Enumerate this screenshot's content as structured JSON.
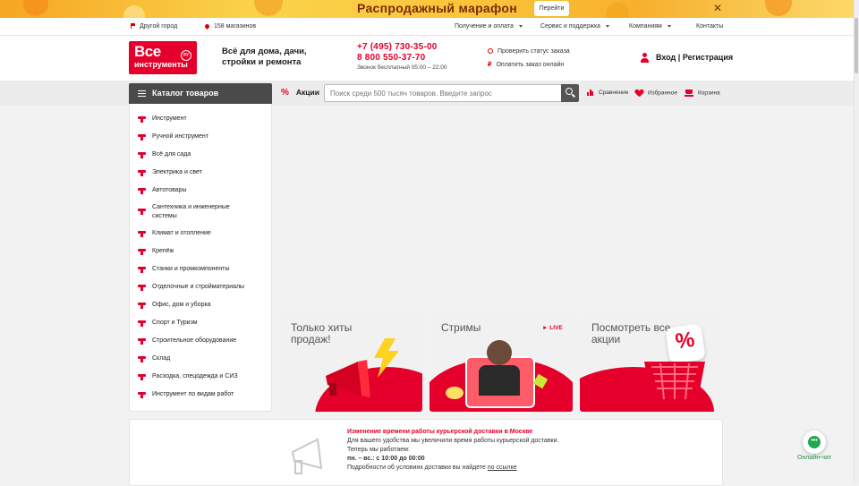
{
  "promo": {
    "title": "Распродажный марафон",
    "button": "Перейти",
    "close_icon": "close-icon"
  },
  "topbar": {
    "city": "Другой город",
    "stores": "158 магазинов",
    "menus": [
      "Получение и оплата",
      "Сервис и поддержка",
      "Компаниям"
    ],
    "contacts": "Контакты"
  },
  "header": {
    "logo_line1": "Все",
    "logo_line2": "инструменты",
    "logo_badge": "ру",
    "slogan": "Всё для дома, дачи, стройки и ремонта",
    "phone1": "+7 (495) 730-35-00",
    "phone2": "8 800 550-37-70",
    "call_note": "Звонок бесплатный 05:00 – 22:00",
    "check_status": "Проверить статус заказа",
    "pay_online": "Оплатить заказ онлайн",
    "login": "Вход",
    "separator": "|",
    "register": "Регистрация"
  },
  "nav": {
    "catalog": "Каталог товаров",
    "promos": "Акции",
    "search_placeholder": "Поиск среди 500 тысяч товаров. Введите запрос",
    "compare": "Сравнение",
    "favorites": "Избранное",
    "cart": "Корзина"
  },
  "catalog": [
    "Инструмент",
    "Ручной инструмент",
    "Всё для сада",
    "Электрика и свет",
    "Автотовары",
    "Сантехника и инженерные системы",
    "Климат и отопление",
    "Крепёж",
    "Станки и промкомпоненты",
    "Отделочные и стройматериалы",
    "Офис, дом и уборка",
    "Спорт и Туризм",
    "Строительное оборудование",
    "Склад",
    "Расходка, спецодежда и СИЗ",
    "Инструмент по видам работ"
  ],
  "tiles": [
    {
      "title": "Только хиты продаж!"
    },
    {
      "title": "Стримы",
      "badge": "► LIVE"
    },
    {
      "title": "Посмотреть все акции",
      "badge": "%"
    }
  ],
  "notice": {
    "title": "Изменение времени работы курьерской доставки в Москве",
    "line1": "Для вашего удобства мы увеличили время работы курьерской доставки.",
    "line2": "Теперь мы работаем:",
    "line3": "пн. – вс.: с 10:00 до 00:00",
    "line4_text": "Подробности об условиях доставки вы найдете",
    "line4_link": "по ссылке"
  },
  "chat": {
    "label": "Онлайн-чат",
    "icon_glyph": "•••"
  },
  "colors": {
    "accent": "#e4002b",
    "dark": "#4a4a4a",
    "chat": "#22a650"
  }
}
